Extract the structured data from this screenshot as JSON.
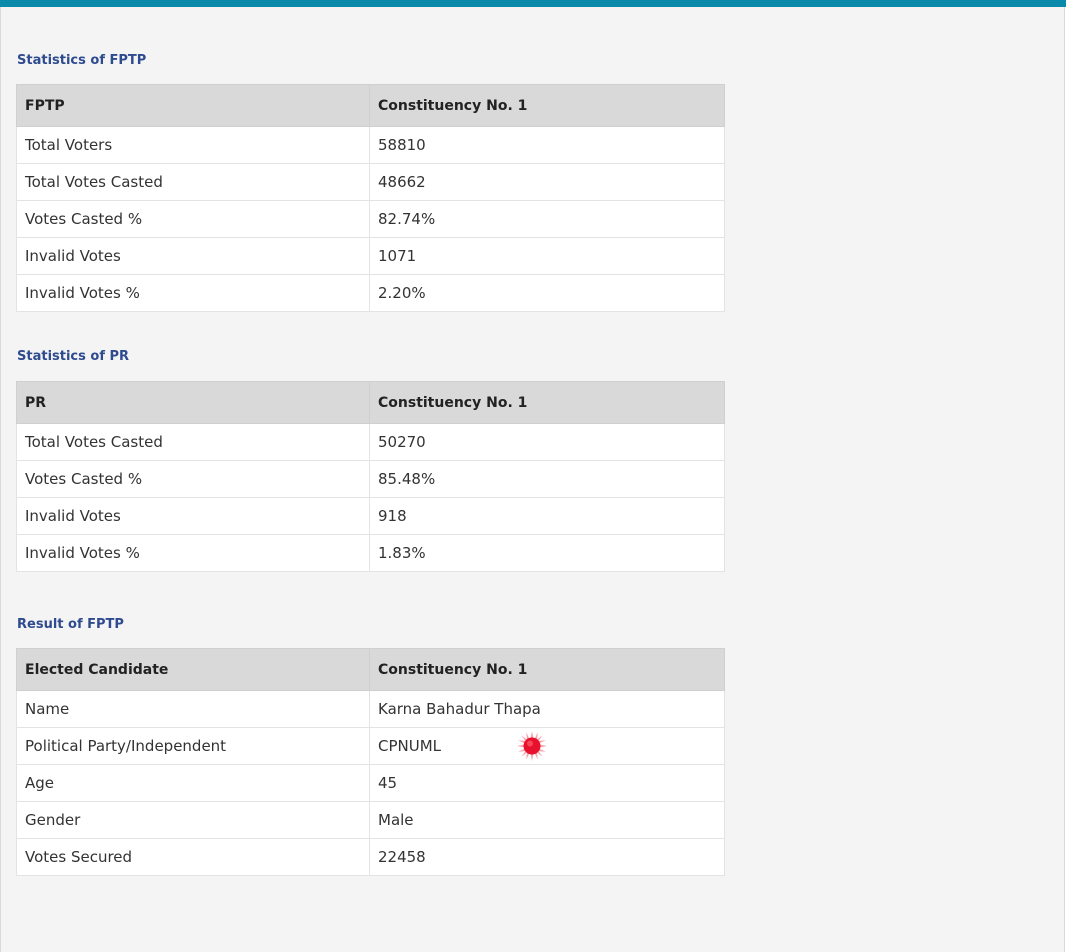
{
  "fptp_stats": {
    "title": "Statistics of FPTP",
    "header": [
      "FPTP",
      "Constituency No. 1"
    ],
    "rows": [
      {
        "label": "Total Voters",
        "value": "58810"
      },
      {
        "label": "Total Votes Casted",
        "value": "48662"
      },
      {
        "label": "Votes Casted %",
        "value": "82.74%"
      },
      {
        "label": "Invalid Votes",
        "value": "1071"
      },
      {
        "label": "Invalid Votes %",
        "value": "2.20%"
      }
    ]
  },
  "pr_stats": {
    "title": "Statistics of PR",
    "header": [
      "PR",
      "Constituency No. 1"
    ],
    "rows": [
      {
        "label": "Total Votes Casted",
        "value": "50270"
      },
      {
        "label": "Votes Casted %",
        "value": "85.48%"
      },
      {
        "label": "Invalid Votes",
        "value": "918"
      },
      {
        "label": "Invalid Votes %",
        "value": "1.83%"
      }
    ]
  },
  "fptp_result": {
    "title": "Result of FPTP",
    "header": [
      "Elected Candidate",
      "Constituency No. 1"
    ],
    "rows": [
      {
        "label": "Name",
        "value": "Karna Bahadur Thapa"
      },
      {
        "label": "Political Party/Independent",
        "value": "CPNUML",
        "symbol_icon": "sun-party-symbol-icon"
      },
      {
        "label": "Age",
        "value": "45"
      },
      {
        "label": "Gender",
        "value": "Male"
      },
      {
        "label": "Votes Secured",
        "value": "22458"
      }
    ]
  },
  "colors": {
    "top_bar": "#0a8aaa",
    "section_title": "#2f4b8f",
    "header_bg": "#d9d9d9",
    "party_symbol": "#e8112d"
  }
}
